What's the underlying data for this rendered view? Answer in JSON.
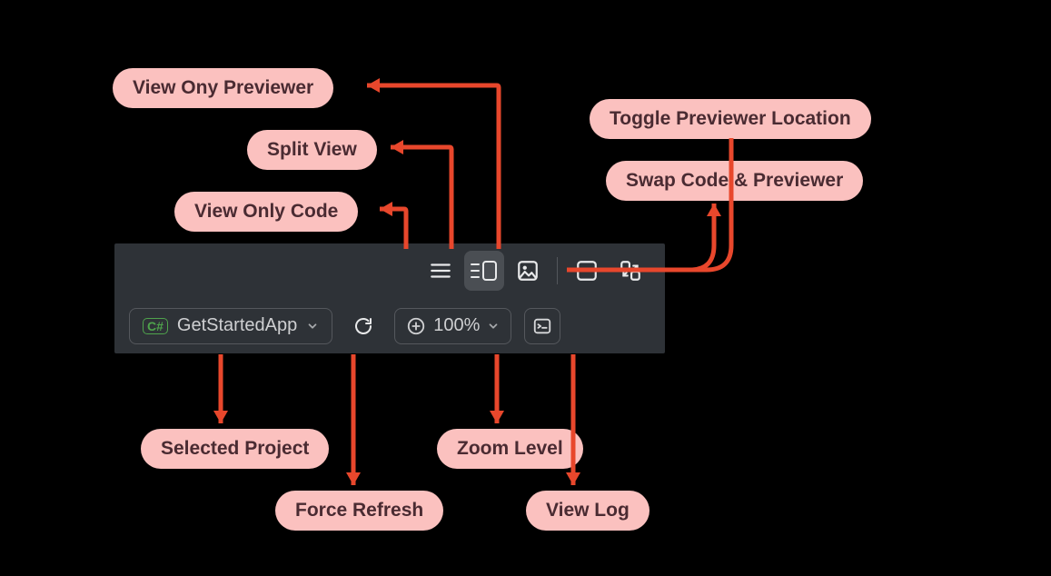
{
  "labels": {
    "view_only_previewer": "View Ony Previewer",
    "split_view": "Split View",
    "view_only_code": "View Only Code",
    "toggle_previewer_location": "Toggle Previewer Location",
    "swap_code_previewer": "Swap Code & Previewer",
    "selected_project": "Selected Project",
    "force_refresh": "Force Refresh",
    "zoom_level": "Zoom Level",
    "view_log": "View Log"
  },
  "toolbar": {
    "project_name": "GetStartedApp",
    "project_badge": "C#",
    "zoom_value": "100%"
  },
  "colors": {
    "label_bg": "#fbc1bf",
    "label_fg": "#4a2b32",
    "panel_bg": "#2e3237",
    "arrow": "#e8472c",
    "badge": "#4fa34c"
  }
}
